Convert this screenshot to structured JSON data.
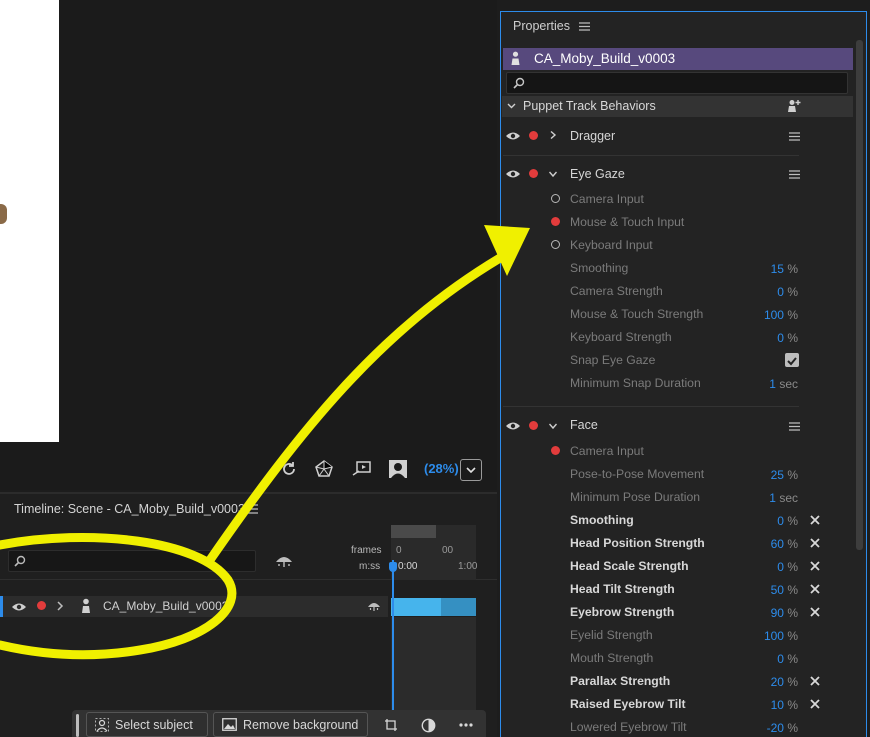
{
  "scene": {
    "zoom_label": "(28%)"
  },
  "timeline": {
    "title": "Timeline: Scene - CA_Moby_Build_v0003",
    "frames_label": "frames",
    "time_label": "m:ss",
    "ruler_top": [
      "0",
      "00"
    ],
    "ruler_time": [
      "0:00",
      "1:00"
    ],
    "row_name": "CA_Moby_Build_v0003"
  },
  "bottom_bar": {
    "select_subject": "Select subject",
    "remove_background": "Remove background"
  },
  "properties": {
    "title": "Properties",
    "puppet_name": "CA_Moby_Build_v0003",
    "section": "Puppet Track Behaviors",
    "behaviors": {
      "dragger": {
        "name": "Dragger"
      },
      "eye_gaze": {
        "name": "Eye Gaze",
        "inputs": [
          {
            "label": "Camera Input",
            "selected": false
          },
          {
            "label": "Mouse & Touch Input",
            "selected": true
          },
          {
            "label": "Keyboard Input",
            "selected": false
          }
        ],
        "params": [
          {
            "label": "Smoothing",
            "value": "15",
            "unit": "%"
          },
          {
            "label": "Camera Strength",
            "value": "0",
            "unit": "%"
          },
          {
            "label": "Mouse & Touch Strength",
            "value": "100",
            "unit": "%"
          },
          {
            "label": "Keyboard Strength",
            "value": "0",
            "unit": "%"
          },
          {
            "label": "Snap Eye Gaze",
            "checked": true
          },
          {
            "label": "Minimum Snap Duration",
            "value": "1",
            "unit": "sec"
          }
        ]
      },
      "face": {
        "name": "Face",
        "input": "Camera Input",
        "params": [
          {
            "label": "Pose-to-Pose Movement",
            "value": "25",
            "unit": "%",
            "changed": false
          },
          {
            "label": "Minimum Pose Duration",
            "value": "1",
            "unit": "sec",
            "changed": false
          },
          {
            "label": "Smoothing",
            "value": "0",
            "unit": "%",
            "changed": true
          },
          {
            "label": "Head Position Strength",
            "value": "60",
            "unit": "%",
            "changed": true
          },
          {
            "label": "Head Scale Strength",
            "value": "0",
            "unit": "%",
            "changed": true
          },
          {
            "label": "Head Tilt Strength",
            "value": "50",
            "unit": "%",
            "changed": true
          },
          {
            "label": "Eyebrow Strength",
            "value": "90",
            "unit": "%",
            "changed": true
          },
          {
            "label": "Eyelid Strength",
            "value": "100",
            "unit": "%",
            "changed": false
          },
          {
            "label": "Mouth Strength",
            "value": "0",
            "unit": "%",
            "changed": false
          },
          {
            "label": "Parallax Strength",
            "value": "20",
            "unit": "%",
            "changed": true
          },
          {
            "label": "Raised Eyebrow Tilt",
            "value": "10",
            "unit": "%",
            "changed": true
          },
          {
            "label": "Lowered Eyebrow Tilt",
            "value": "-20",
            "unit": "%",
            "changed": false
          }
        ]
      }
    }
  },
  "colors": {
    "accent": "#2d8ceb",
    "record": "#e23c3c",
    "puppet_bar": "#57497d",
    "annotation": "#f0f000"
  }
}
